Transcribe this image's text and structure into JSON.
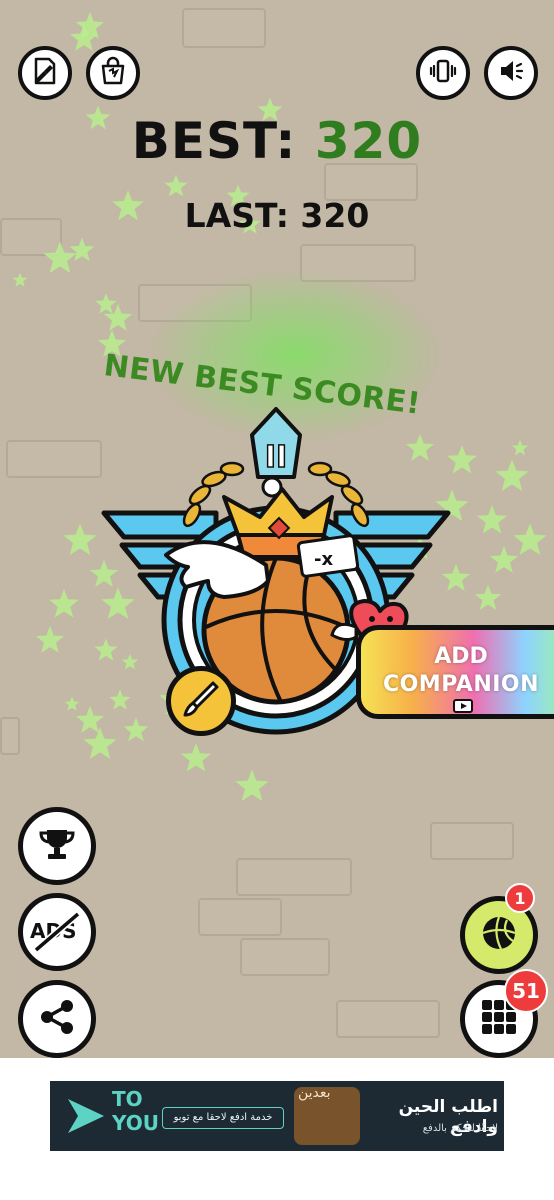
{
  "scores": {
    "best_label": "BEST:",
    "best_value": "320",
    "last_label": "LAST:",
    "last_value": "320",
    "new_best_text": "NEW BEST SCORE!"
  },
  "emblem": {
    "rank_numeral": "II"
  },
  "companion_button": {
    "line1": "ADD",
    "line2": "COMPANION",
    "icon": "video-play-icon"
  },
  "top_left_buttons": [
    {
      "name": "feedback-icon"
    },
    {
      "name": "shop-bag-icon"
    }
  ],
  "top_right_buttons": [
    {
      "name": "vibration-icon"
    },
    {
      "name": "sound-icon"
    }
  ],
  "left_buttons": [
    {
      "name": "trophy-icon"
    },
    {
      "name": "no-ads-icon",
      "label": "ADS"
    },
    {
      "name": "share-icon"
    }
  ],
  "right_buttons": [
    {
      "name": "basketball-icon",
      "badge": "1"
    },
    {
      "name": "grid-menu-icon",
      "badge": "51"
    }
  ],
  "ad_banner": {
    "brand_to": "TO",
    "brand_you": "YOU",
    "slogan": "خدمة ادفع لاحقا مع توبو",
    "headline": "اطلب الحين وادفع",
    "subline": "لاحقًا لتحكم بالدفع",
    "deco": "بعدين"
  },
  "colors": {
    "background": "#c3b7a5",
    "best_value": "#2f7d1f",
    "new_best": "#3b8a22",
    "badge": "#ee3b3b",
    "wing_blue": "#5bc8f0",
    "ball": "#e08a3c"
  }
}
